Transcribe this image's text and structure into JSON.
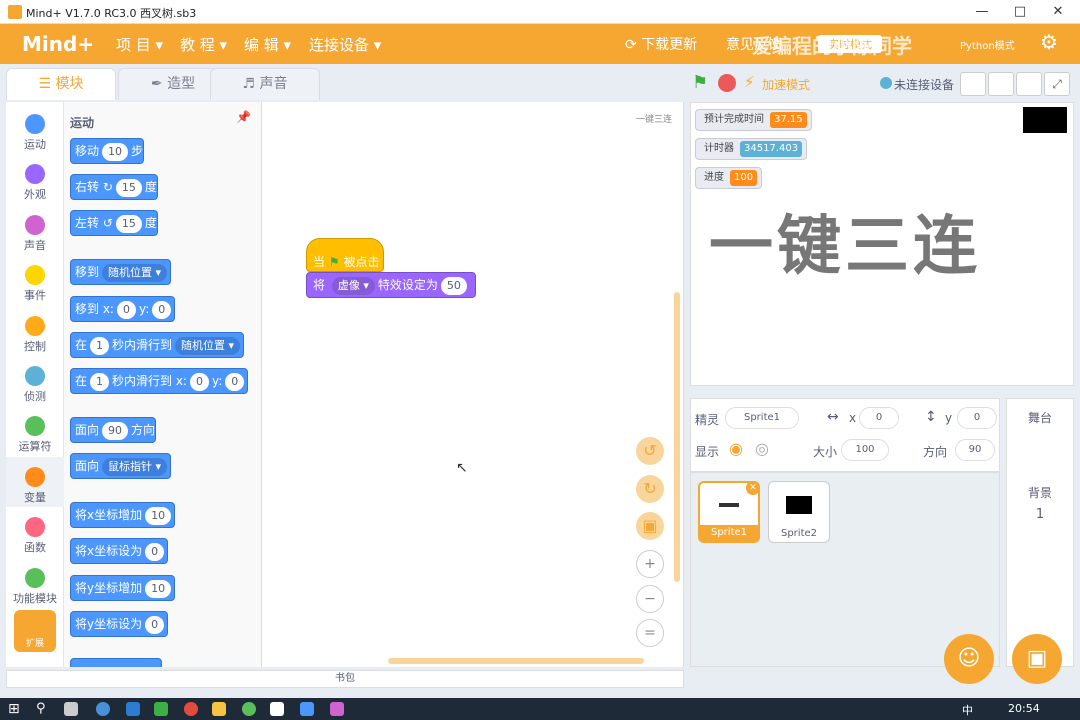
{
  "window": {
    "title": "Mind+ V1.7.0 RC3.0  西叉树.sb3"
  },
  "menubar": {
    "logo": "Mind+",
    "items": [
      "项 目",
      "教 程",
      "编 辑",
      "连接设备"
    ],
    "right": [
      "下载更新",
      "意见反馈",
      "实时模式",
      "Python模式"
    ]
  },
  "watermark": "爱编程的小陈同学",
  "tabs": [
    "模块",
    "造型",
    "声音"
  ],
  "controls": {
    "accel": "加速模式",
    "device": "未连接设备"
  },
  "categories": [
    {
      "label": "运动",
      "color": "#4c97ff"
    },
    {
      "label": "外观",
      "color": "#9966ff"
    },
    {
      "label": "声音",
      "color": "#cf63cf"
    },
    {
      "label": "事件",
      "color": "#ffd500"
    },
    {
      "label": "控制",
      "color": "#ffab19"
    },
    {
      "label": "侦测",
      "color": "#5cb1d6"
    },
    {
      "label": "运算符",
      "color": "#59c059"
    },
    {
      "label": "变量",
      "color": "#ff8c1a"
    },
    {
      "label": "函数",
      "color": "#ff6680"
    },
    {
      "label": "功能模块",
      "color": "#59c059"
    },
    {
      "label": "扩展",
      "color": "#f6a732"
    }
  ],
  "palette": {
    "header": "运动",
    "blocks": {
      "move": [
        "移动",
        "10",
        "步"
      ],
      "turn_right": [
        "右转",
        "15",
        "度"
      ],
      "turn_left": [
        "左转",
        "15",
        "度"
      ],
      "goto": [
        "移到",
        "随机位置"
      ],
      "goto_xy": [
        "移到 x:",
        "0",
        "y:",
        "0"
      ],
      "glide": [
        "在",
        "1",
        "秒内滑行到",
        "随机位置"
      ],
      "glide_xy": [
        "在",
        "1",
        "秒内滑行到 x:",
        "0",
        "y:",
        "0"
      ],
      "point_dir": [
        "面向",
        "90",
        "方向"
      ],
      "point_towards": [
        "面向",
        "鼠标指针"
      ],
      "change_x": [
        "将x坐标增加",
        "10"
      ],
      "set_x": [
        "将x坐标设为",
        "0"
      ],
      "change_y": [
        "将y坐标增加",
        "10"
      ],
      "set_y": [
        "将y坐标设为",
        "0"
      ]
    }
  },
  "script": {
    "corner_label": "一键三连",
    "hat": [
      "当",
      "被点击"
    ],
    "looks": [
      "将",
      "虚像",
      "特效设定为",
      "50"
    ]
  },
  "stage": {
    "monitors": [
      {
        "label": "预计完成时间",
        "value": "37.15",
        "color": "#ff8c1a"
      },
      {
        "label": "计时器",
        "value": "34517.403",
        "color": "#5cb1d6"
      },
      {
        "label": "进度",
        "value": "100",
        "color": "#ff8c1a"
      }
    ],
    "big_text": "一键三连"
  },
  "sprite_info": {
    "sprite_label": "精灵",
    "sprite_name": "Sprite1",
    "x_label": "x",
    "x": "0",
    "y_label": "y",
    "y": "0",
    "show_label": "显示",
    "size_label": "大小",
    "size": "100",
    "dir_label": "方向",
    "dir": "90"
  },
  "sprites": [
    "Sprite1",
    "Sprite2"
  ],
  "stage_panel": {
    "title": "舞台",
    "backdrop_label": "背景",
    "backdrop_count": "1"
  },
  "backpack": "书包",
  "taskbar": {
    "time": "20:54",
    "ime": "中"
  }
}
